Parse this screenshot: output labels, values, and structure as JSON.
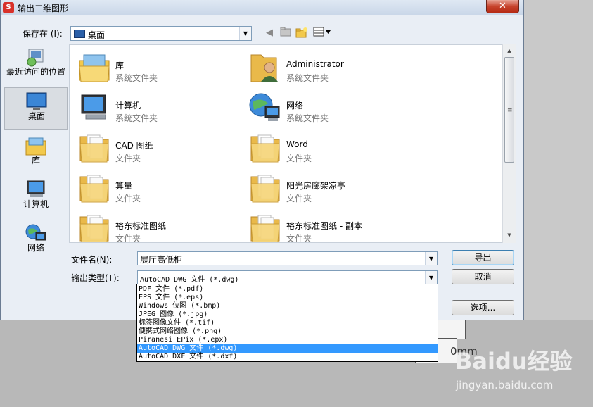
{
  "window": {
    "title": "输出二维图形",
    "close_glyph": "✕"
  },
  "toolbar": {
    "save_in_label": "保存在 (I):",
    "save_in_value": "桌面",
    "icons": [
      "back-arrow-icon",
      "up-folder-icon",
      "new-folder-icon",
      "views-menu-icon"
    ]
  },
  "places": [
    {
      "label": "最近访问的位置",
      "icon": "recent-places-icon"
    },
    {
      "label": "桌面",
      "icon": "desktop-icon",
      "selected": true
    },
    {
      "label": "库",
      "icon": "library-icon"
    },
    {
      "label": "计算机",
      "icon": "computer-icon"
    },
    {
      "label": "网络",
      "icon": "network-icon"
    }
  ],
  "files": [
    {
      "name": "库",
      "type": "系统文件夹",
      "icon": "library-icon"
    },
    {
      "name": "Administrator",
      "type": "系统文件夹",
      "icon": "user-folder-icon"
    },
    {
      "name": "计算机",
      "type": "系统文件夹",
      "icon": "computer-icon"
    },
    {
      "name": "网络",
      "type": "系统文件夹",
      "icon": "network-icon"
    },
    {
      "name": "CAD 图纸",
      "type": "文件夹",
      "icon": "folder-icon"
    },
    {
      "name": "Word",
      "type": "文件夹",
      "icon": "folder-icon"
    },
    {
      "name": "算量",
      "type": "文件夹",
      "icon": "folder-icon"
    },
    {
      "name": "阳光房廊架凉亭",
      "type": "文件夹",
      "icon": "folder-icon"
    },
    {
      "name": "裕东标准图纸",
      "type": "文件夹",
      "icon": "folder-icon"
    },
    {
      "name": "裕东标准图纸 - 副本",
      "type": "文件夹",
      "icon": "folder-icon"
    }
  ],
  "form": {
    "filename_label": "文件名(N):",
    "filename_value": "展厅高低柜",
    "filetype_label": "输出类型(T):",
    "filetype_value": "AutoCAD DWG 文件 (*.dwg)"
  },
  "buttons": {
    "export": "导出",
    "cancel": "取消",
    "options": "选项..."
  },
  "filetype_options": [
    "PDF 文件 (*.pdf)",
    "EPS 文件 (*.eps)",
    "Windows 位图 (*.bmp)",
    "JPEG 图像 (*.jpg)",
    "标签图像文件 (*.tif)",
    "便携式网络图像 (*.png)",
    "Piranesi EPix (*.epx)",
    "AutoCAD DWG 文件 (*.dwg)",
    "AutoCAD DXF 文件 (*.dxf)"
  ],
  "selected_option_index": 7,
  "background": {
    "unit_text": "0mm"
  },
  "watermark": {
    "brand": "Baidu经验",
    "url": "jingyan.baidu.com"
  },
  "colors": {
    "selection": "#3399ff",
    "close": "#c7432c",
    "folder": "#f2c94c"
  }
}
